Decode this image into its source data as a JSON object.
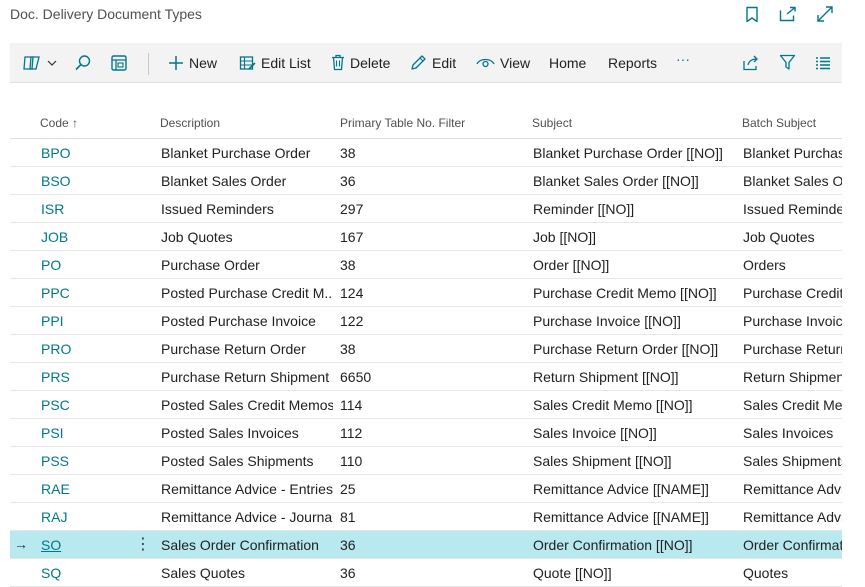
{
  "window": {
    "title": "Doc. Delivery Document Types",
    "icons": [
      "bookmark-icon",
      "open-in-new-window-icon",
      "expand-icon"
    ]
  },
  "actionbar": {
    "new": "New",
    "edit_list": "Edit List",
    "delete": "Delete",
    "edit": "Edit",
    "view": "View",
    "home": "Home",
    "reports": "Reports",
    "more": "···"
  },
  "columns": {
    "code": "Code",
    "code_sort": "↑",
    "description": "Description",
    "primary_table": "Primary Table No. Filter",
    "subject": "Subject",
    "batch_subject": "Batch Subject"
  },
  "rows": [
    {
      "code": "BPO",
      "description": "Blanket Purchase Order",
      "primary_table": "38",
      "subject": "Blanket Purchase Order [[NO]]",
      "batch_subject": "Blanket Purchase"
    },
    {
      "code": "BSO",
      "description": "Blanket Sales Order",
      "primary_table": "36",
      "subject": "Blanket Sales Order [[NO]]",
      "batch_subject": "Blanket Sales Or"
    },
    {
      "code": "ISR",
      "description": "Issued Reminders",
      "primary_table": "297",
      "subject": "Reminder [[NO]]",
      "batch_subject": "Issued Reminder"
    },
    {
      "code": "JOB",
      "description": "Job Quotes",
      "primary_table": "167",
      "subject": "Job [[NO]]",
      "batch_subject": "Job Quotes"
    },
    {
      "code": "PO",
      "description": "Purchase Order",
      "primary_table": "38",
      "subject": "Order [[NO]]",
      "batch_subject": "Orders"
    },
    {
      "code": "PPC",
      "description": "Posted Purchase Credit M...",
      "primary_table": "124",
      "subject": "Purchase Credit Memo [[NO]]",
      "batch_subject": "Purchase Credit"
    },
    {
      "code": "PPI",
      "description": "Posted Purchase Invoice",
      "primary_table": "122",
      "subject": "Purchase Invoice [[NO]]",
      "batch_subject": "Purchase Invoice"
    },
    {
      "code": "PRO",
      "description": "Purchase Return Order",
      "primary_table": "38",
      "subject": "Purchase Return Order [[NO]]",
      "batch_subject": "Purchase Return"
    },
    {
      "code": "PRS",
      "description": "Purchase Return Shipment",
      "primary_table": "6650",
      "subject": "Return Shipment [[NO]]",
      "batch_subject": "Return Shipmen"
    },
    {
      "code": "PSC",
      "description": "Posted Sales Credit Memos",
      "primary_table": "114",
      "subject": "Sales Credit Memo [[NO]]",
      "batch_subject": "Sales Credit Mer"
    },
    {
      "code": "PSI",
      "description": "Posted Sales Invoices",
      "primary_table": "112",
      "subject": "Sales Invoice [[NO]]",
      "batch_subject": "Sales Invoices"
    },
    {
      "code": "PSS",
      "description": "Posted Sales Shipments",
      "primary_table": "110",
      "subject": "Sales Shipment [[NO]]",
      "batch_subject": "Sales Shipments"
    },
    {
      "code": "RAE",
      "description": "Remittance Advice - Entries",
      "primary_table": "25",
      "subject": "Remittance Advice [[NAME]]",
      "batch_subject": "Remittance Advi"
    },
    {
      "code": "RAJ",
      "description": "Remittance Advice - Journal",
      "primary_table": "81",
      "subject": "Remittance Advice [[NAME]]",
      "batch_subject": "Remittance Advi"
    },
    {
      "code": "SO",
      "description": "Sales Order Confirmation",
      "primary_table": "36",
      "subject": "Order Confirmation [[NO]]",
      "batch_subject": "Order Confirmat",
      "selected": true
    },
    {
      "code": "SQ",
      "description": "Sales Quotes",
      "primary_table": "36",
      "subject": "Quote [[NO]]",
      "batch_subject": "Quotes"
    }
  ],
  "row_marker": "→",
  "row_menu": "⋮",
  "colors": {
    "accent": "#00788c",
    "selected_row": "#b8e9ee",
    "actionbar_bg": "#f3f3f3"
  }
}
